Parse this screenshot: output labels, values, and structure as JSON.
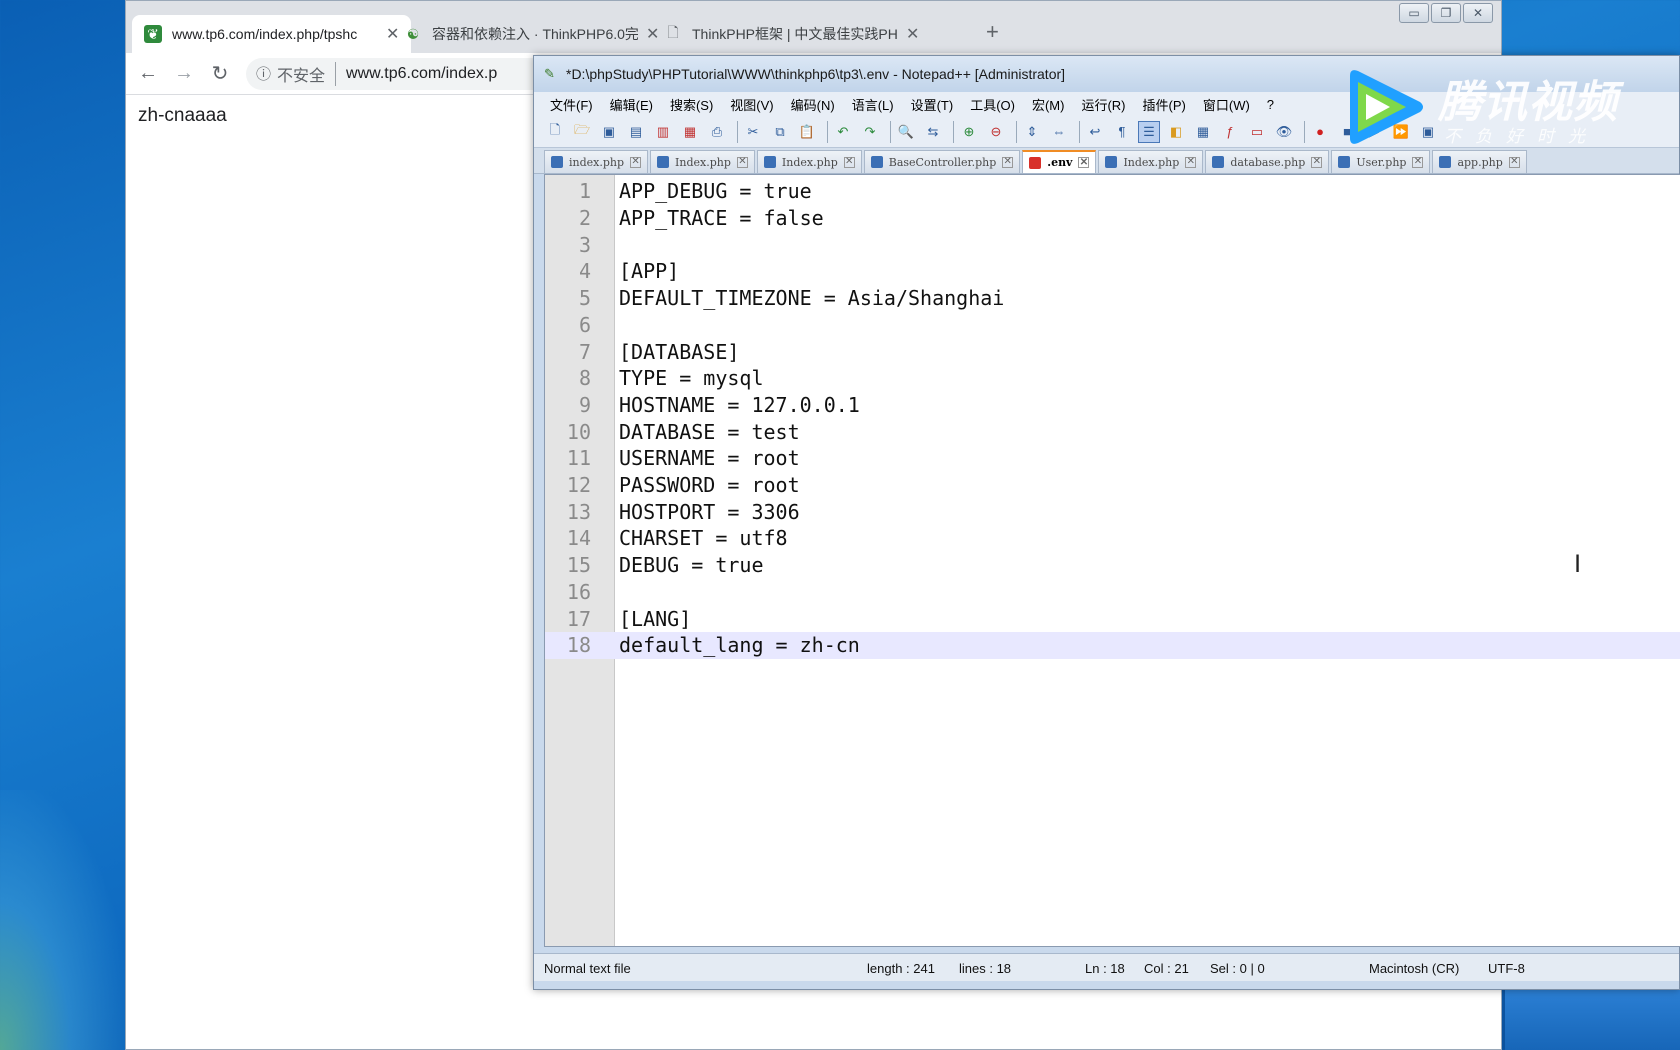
{
  "browser": {
    "tabs": [
      {
        "title": "www.tp6.com/index.php/tpshc",
        "icon": "leaf-favicon-icon",
        "active": true
      },
      {
        "title": "容器和依赖注入 · ThinkPHP6.0完",
        "icon": "book-favicon-icon",
        "active": false
      },
      {
        "title": "ThinkPHP框架 | 中文最佳实践PH",
        "icon": "page-icon",
        "active": false
      }
    ],
    "new_tab": "+",
    "close_glyph": "✕",
    "insecure_label": "不安全",
    "url": "www.tp6.com/index.p",
    "page_text": "zh-cnaaaa"
  },
  "notepad": {
    "title": "*D:\\phpStudy\\PHPTutorial\\WWW\\thinkphp6\\tp3\\.env - Notepad++ [Administrator]",
    "menu": [
      "文件(F)",
      "编辑(E)",
      "搜索(S)",
      "视图(V)",
      "编码(N)",
      "语言(L)",
      "设置(T)",
      "工具(O)",
      "宏(M)",
      "运行(R)",
      "插件(P)",
      "窗口(W)",
      "?"
    ],
    "file_tabs": [
      {
        "name": "index.php",
        "active": false
      },
      {
        "name": "Index.php",
        "active": false
      },
      {
        "name": "Index.php",
        "active": false
      },
      {
        "name": "BaseController.php",
        "active": false
      },
      {
        "name": ".env",
        "active": true
      },
      {
        "name": "Index.php",
        "active": false
      },
      {
        "name": "database.php",
        "active": false
      },
      {
        "name": "User.php",
        "active": false
      },
      {
        "name": "app.php",
        "active": false
      }
    ],
    "lines": [
      "APP_DEBUG = true",
      "APP_TRACE = false",
      "",
      "[APP]",
      "DEFAULT_TIMEZONE = Asia/Shanghai",
      "",
      "[DATABASE]",
      "TYPE = mysql",
      "HOSTNAME = 127.0.0.1",
      "DATABASE = test",
      "USERNAME = root",
      "PASSWORD = root",
      "HOSTPORT = 3306",
      "CHARSET = utf8",
      "DEBUG = true",
      "",
      "[LANG]",
      "default_lang = zh-cn"
    ],
    "current_line": 18,
    "status": {
      "file_type": "Normal text file",
      "length": "length : 241",
      "lines": "lines : 18",
      "ln": "Ln : 18",
      "col": "Col : 21",
      "sel": "Sel : 0 | 0",
      "eol": "Macintosh (CR)",
      "encoding": "UTF-8"
    }
  },
  "watermark": {
    "brand": "腾讯视频",
    "slogan": "不负好时光"
  },
  "colors": {
    "desktop": "#0a5fb4",
    "current_line": "#e8e8ff",
    "active_tab_accent": "#f08c24"
  }
}
